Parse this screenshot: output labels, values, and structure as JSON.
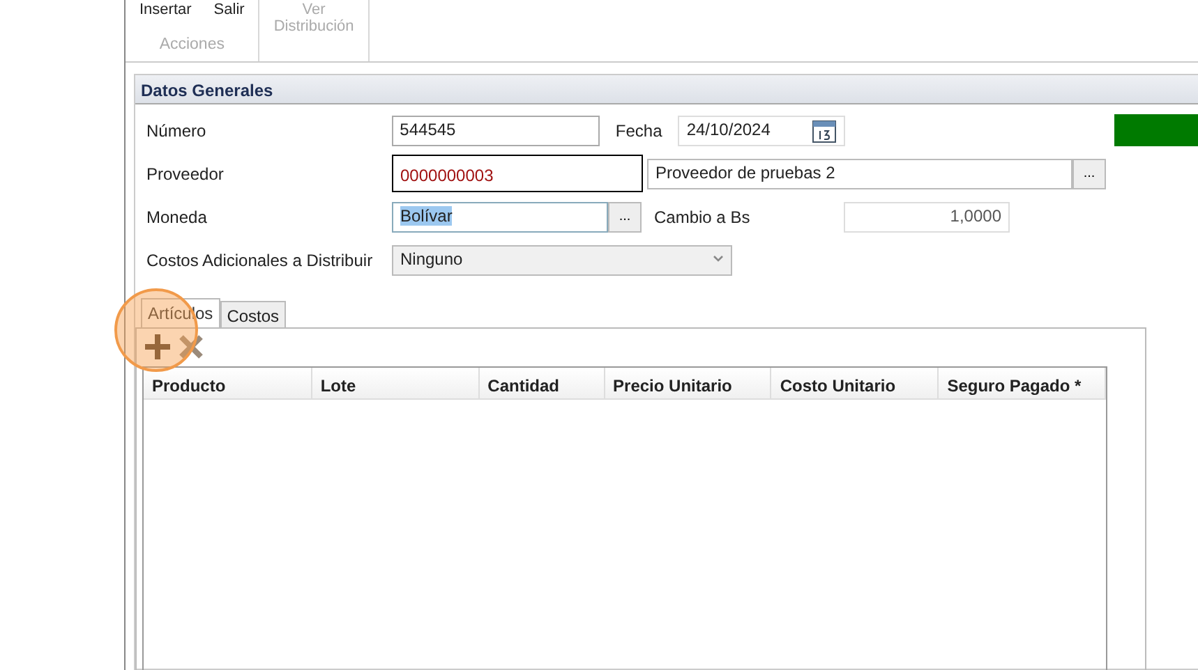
{
  "ribbon": {
    "groups": [
      {
        "label": "Acciones",
        "buttons": [
          {
            "label": "Insertar",
            "disabled": false
          },
          {
            "label": "Salir",
            "disabled": false
          }
        ]
      },
      {
        "buttons": [
          {
            "label": "Ver\nDistribución",
            "disabled": true
          }
        ]
      }
    ]
  },
  "section": {
    "title": "Datos Generales"
  },
  "form": {
    "numero": {
      "label": "Número",
      "value": "544545"
    },
    "fecha": {
      "label": "Fecha",
      "value": "24/10/2024"
    },
    "proveedor": {
      "label": "Proveedor",
      "code": "0000000003",
      "name": "Proveedor de pruebas 2"
    },
    "moneda": {
      "label": "Moneda",
      "value": "Bolívar",
      "highlighted": true
    },
    "cambio": {
      "label": "Cambio a Bs",
      "value": "1,0000",
      "disabled": true
    },
    "costos": {
      "label": "Costos Adicionales a Distribuir",
      "value": "Ninguno"
    },
    "browse_label": "..."
  },
  "tabs": [
    {
      "label": "Artículos",
      "selected": true
    },
    {
      "label": "Costos",
      "selected": false
    }
  ],
  "toolbar": [
    {
      "kind": "add",
      "disabled": false
    },
    {
      "kind": "delete",
      "disabled": true
    }
  ],
  "table": {
    "columns": [
      "Producto",
      "Lote",
      "Cantidad",
      "Precio Unitario",
      "Costo Unitario",
      "Seguro Pagado *"
    ]
  }
}
